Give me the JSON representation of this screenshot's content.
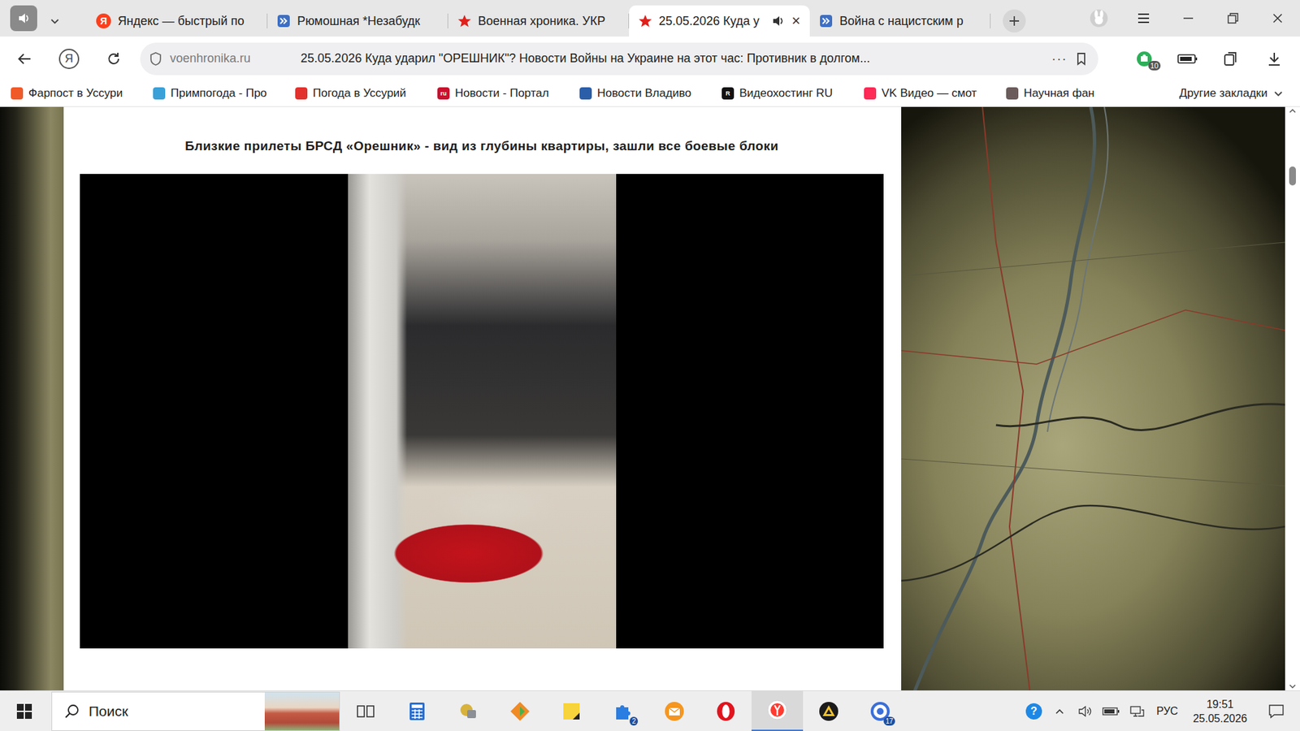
{
  "tabs": [
    {
      "label": "Яндекс — быстрый по",
      "selected": false,
      "kind": "yandex",
      "icon_text": "Я",
      "playing": false
    },
    {
      "label": "Рюмошная *Незабудк",
      "selected": false,
      "kind": "site",
      "playing": false
    },
    {
      "label": "Военная хроника. УКР",
      "selected": false,
      "kind": "star",
      "playing": false
    },
    {
      "label": "25.05.2026 Куда у",
      "selected": true,
      "kind": "star",
      "playing": true,
      "close": "×"
    },
    {
      "label": "Война с нацистским р",
      "selected": false,
      "kind": "site",
      "playing": false
    }
  ],
  "address_bar": {
    "yandex_button": "Я",
    "domain": "voenhronika.ru",
    "title": "25.05.2026 Куда ударил \"ОРЕШНИК\"? Новости Войны на Украине на этот час: Противник в долгом...",
    "more": "···",
    "bookmarked": false
  },
  "extensions": {
    "badge": "10"
  },
  "bookmarks": [
    {
      "label": "Фарпост в Уссури",
      "color": "#f05a28"
    },
    {
      "label": "Примпогода - Про",
      "color": "#3aa0d8"
    },
    {
      "label": "Погода в Уссурий",
      "color": "#e2312d"
    },
    {
      "label": "Новости - Портал",
      "color": "#c8102e",
      "icon_text": "ru"
    },
    {
      "label": "Новости Владиво",
      "color": "#2b5ea8"
    },
    {
      "label": "Видеохостинг RU",
      "color": "#111111",
      "icon_text": "R"
    },
    {
      "label": "VK Видео — смот",
      "color": "#ff2a55"
    },
    {
      "label": "Научная фан",
      "color": "#6b5b5b"
    }
  ],
  "other_bookmarks": "Другие закладки",
  "page": {
    "heading": "Близкие прилеты БРСД «Орешник» - вид из глубины квартиры, зашли все боевые блоки"
  },
  "taskbar": {
    "search_placeholder": "Поиск",
    "apps": [
      {
        "kind": "task-view",
        "selected": false
      },
      {
        "kind": "calculator",
        "selected": false
      },
      {
        "kind": "gold-app",
        "selected": false
      },
      {
        "kind": "folder-app",
        "selected": false
      },
      {
        "kind": "sticky-notes",
        "selected": false
      },
      {
        "kind": "puzzle",
        "selected": false,
        "badge": "2"
      },
      {
        "kind": "mail",
        "selected": false
      },
      {
        "kind": "opera",
        "selected": false
      },
      {
        "kind": "yandex-browser",
        "selected": true
      },
      {
        "kind": "triangle-app",
        "selected": false
      },
      {
        "kind": "circle-app",
        "selected": false,
        "badge": "17"
      }
    ],
    "tray": {
      "help": "?",
      "language": "РУС",
      "time": "19:51",
      "date": "25.05.2026"
    }
  }
}
